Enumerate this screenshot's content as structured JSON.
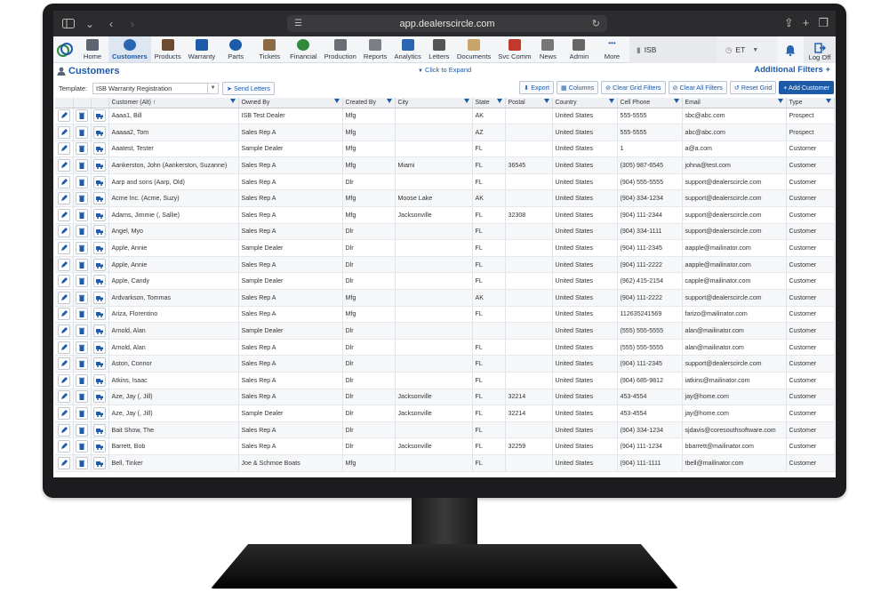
{
  "browser": {
    "url": "app.dealerscircle.com"
  },
  "nav": {
    "items": [
      {
        "label": "Home",
        "icon": "home-icon",
        "color": "#5b6470"
      },
      {
        "label": "Customers",
        "icon": "people-icon",
        "color": "#2b66b3",
        "active": true
      },
      {
        "label": "Products",
        "icon": "box-icon",
        "color": "#6e4a2e"
      },
      {
        "label": "Warranty",
        "icon": "shield-icon",
        "color": "#1d5aa8"
      },
      {
        "label": "Parts",
        "icon": "gear-icon",
        "color": "#1d5aa8"
      },
      {
        "label": "Tickets",
        "icon": "clipboard-icon",
        "color": "#8a6a43"
      },
      {
        "label": "Financial",
        "icon": "dollar-icon",
        "color": "#2f8a3e"
      },
      {
        "label": "Production",
        "icon": "factory-icon",
        "color": "#6b6f75"
      },
      {
        "label": "Reports",
        "icon": "report-icon",
        "color": "#7b7f86"
      },
      {
        "label": "Analytics",
        "icon": "chart-icon",
        "color": "#2b66b3"
      },
      {
        "label": "Letters",
        "icon": "envelope-icon",
        "color": "#555"
      },
      {
        "label": "Documents",
        "icon": "folder-icon",
        "color": "#c9a46b"
      },
      {
        "label": "Svc Comm",
        "icon": "antenna-icon",
        "color": "#c0392b"
      },
      {
        "label": "News",
        "icon": "news-icon",
        "color": "#777"
      },
      {
        "label": "Admin",
        "icon": "lock-icon",
        "color": "#666"
      },
      {
        "label": "More",
        "icon": "more-icon",
        "color": "#1d5aa8"
      }
    ],
    "org": "ISB",
    "timezone": "ET",
    "logoff": "Log Off"
  },
  "page": {
    "title": "Customers",
    "expand": "Click to Expand",
    "additional_filters": "Additional Filters +"
  },
  "toolbar": {
    "template_label": "Template:",
    "template_value": "ISB Warranty Registration",
    "send_letters": "Send Letters",
    "export": "Export",
    "columns": "Columns",
    "clear_grid_filters": "Clear Grid Filters",
    "clear_all_filters": "Clear All Filters",
    "reset_grid": "Reset Grid",
    "add_customer": "+ Add Customer"
  },
  "grid": {
    "columns": [
      "Customer (Alt) ↑",
      "Owned By",
      "Created By",
      "City",
      "State",
      "Postal",
      "Country",
      "Cell Phone",
      "Email",
      "Type"
    ],
    "rows": [
      [
        "Aaaa1, Bill",
        "ISB Test Dealer",
        "Mfg",
        "",
        "AK",
        "",
        "United States",
        "555-5555",
        "sbc@abc.com",
        "Prospect"
      ],
      [
        "Aaaaa2, Tom",
        "Sales Rep A",
        "Mfg",
        "",
        "AZ",
        "",
        "United States",
        "555-5555",
        "abc@abc.com",
        "Prospect"
      ],
      [
        "Aaatest, Tester",
        "Sample Dealer",
        "Mfg",
        "",
        "FL",
        "",
        "United States",
        "1",
        "a@a.com",
        "Customer"
      ],
      [
        "Aankerston, John (Aankerston, Suzanne)",
        "Sales Rep A",
        "Mfg",
        "Miami",
        "FL",
        "36545",
        "United States",
        "(305) 987-6545",
        "johna@test.com",
        "Customer"
      ],
      [
        "Aarp and sons (Aarp, Old)",
        "Sales Rep A",
        "Dlr",
        "",
        "FL",
        "",
        "United States",
        "(904) 555-5555",
        "support@dealerscircle.com",
        "Customer"
      ],
      [
        "Acme Inc. (Acme, Suzy)",
        "Sales Rep A",
        "Mfg",
        "Moose Lake",
        "AK",
        "",
        "United States",
        "(904) 334-1234",
        "support@dealerscircle.com",
        "Customer"
      ],
      [
        "Adams, Jimmie (, Sallie)",
        "Sales Rep A",
        "Mfg",
        "Jacksonville",
        "FL",
        "32308",
        "United States",
        "(904) 111-2344",
        "support@dealerscircle.com",
        "Customer"
      ],
      [
        "Angel, Myo",
        "Sales Rep A",
        "Dlr",
        "",
        "FL",
        "",
        "United States",
        "(904) 334-1111",
        "support@dealerscircle.com",
        "Customer"
      ],
      [
        "Apple, Annie",
        "Sample Dealer",
        "Dlr",
        "",
        "FL",
        "",
        "United States",
        "(904) 111-2345",
        "aapple@mailinator.com",
        "Customer"
      ],
      [
        "Apple, Annie",
        "Sales Rep A",
        "Dlr",
        "",
        "FL",
        "",
        "United States",
        "(904) 111-2222",
        "aapple@mailinator.com",
        "Customer"
      ],
      [
        "Apple, Candy",
        "Sample Dealer",
        "Dlr",
        "",
        "FL",
        "",
        "United States",
        "(962) 415-2154",
        "capple@mailinator.com",
        "Customer"
      ],
      [
        "Ardvarkson, Tommas",
        "Sales Rep A",
        "Mfg",
        "",
        "AK",
        "",
        "United States",
        "(904) 111-2222",
        "support@dealerscircle.com",
        "Customer"
      ],
      [
        "Ariza, Florentino",
        "Sales Rep A",
        "Mfg",
        "",
        "FL",
        "",
        "United States",
        "112635241569",
        "farizo@mailinator.com",
        "Customer"
      ],
      [
        "Arnold, Alan",
        "Sample Dealer",
        "Dlr",
        "",
        "",
        "",
        "United States",
        "(555) 555-5555",
        "alan@mailinator.com",
        "Customer"
      ],
      [
        "Arnold, Alan",
        "Sales Rep A",
        "Dlr",
        "",
        "FL",
        "",
        "United States",
        "(555) 555-5555",
        "alan@mailinator.com",
        "Customer"
      ],
      [
        "Aston, Connor",
        "Sales Rep A",
        "Dlr",
        "",
        "FL",
        "",
        "United States",
        "(904) 111-2345",
        "support@dealerscircle.com",
        "Customer"
      ],
      [
        "Atkins, Isaac",
        "Sales Rep A",
        "Dlr",
        "",
        "FL",
        "",
        "United States",
        "(904) 685-9812",
        "iatkins@mailinator.com",
        "Customer"
      ],
      [
        "Aze, Jay (, Jill)",
        "Sales Rep A",
        "Dlr",
        "Jacksonville",
        "FL",
        "32214",
        "United States",
        "453-4554",
        "jay@home.com",
        "Customer"
      ],
      [
        "Aze, Jay (, Jill)",
        "Sample Dealer",
        "Dlr",
        "Jacksonville",
        "FL",
        "32214",
        "United States",
        "453-4554",
        "jay@home.com",
        "Customer"
      ],
      [
        "Bait Show, The",
        "Sales Rep A",
        "Dlr",
        "",
        "FL",
        "",
        "United States",
        "(904) 334-1234",
        "sjdavis@coresouthsoftware.com",
        "Customer"
      ],
      [
        "Barrett, Bob",
        "Sales Rep A",
        "Dlr",
        "Jacksonville",
        "FL",
        "32259",
        "United States",
        "(904) 111-1234",
        "bbarrett@mailinator.com",
        "Customer"
      ],
      [
        "Bell, Tinker",
        "Joe & Schmoe Boats",
        "Mfg",
        "",
        "FL",
        "",
        "United States",
        "(904) 111-1111",
        "tbell@mailinator.com",
        "Customer"
      ]
    ]
  }
}
